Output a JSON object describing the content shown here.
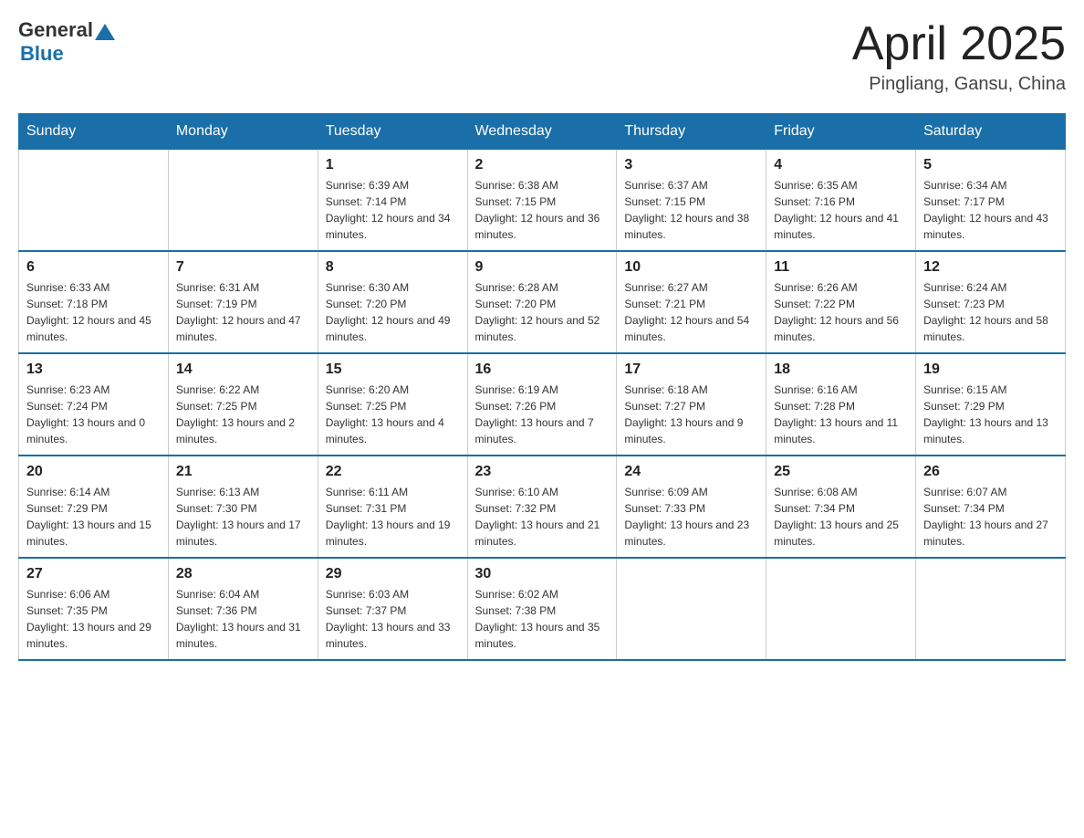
{
  "header": {
    "logo": {
      "text_general": "General",
      "text_blue": "Blue"
    },
    "title": "April 2025",
    "subtitle": "Pingliang, Gansu, China"
  },
  "calendar": {
    "days_of_week": [
      "Sunday",
      "Monday",
      "Tuesday",
      "Wednesday",
      "Thursday",
      "Friday",
      "Saturday"
    ],
    "weeks": [
      [
        {
          "day": "",
          "sunrise": "",
          "sunset": "",
          "daylight": ""
        },
        {
          "day": "",
          "sunrise": "",
          "sunset": "",
          "daylight": ""
        },
        {
          "day": "1",
          "sunrise": "Sunrise: 6:39 AM",
          "sunset": "Sunset: 7:14 PM",
          "daylight": "Daylight: 12 hours and 34 minutes."
        },
        {
          "day": "2",
          "sunrise": "Sunrise: 6:38 AM",
          "sunset": "Sunset: 7:15 PM",
          "daylight": "Daylight: 12 hours and 36 minutes."
        },
        {
          "day": "3",
          "sunrise": "Sunrise: 6:37 AM",
          "sunset": "Sunset: 7:15 PM",
          "daylight": "Daylight: 12 hours and 38 minutes."
        },
        {
          "day": "4",
          "sunrise": "Sunrise: 6:35 AM",
          "sunset": "Sunset: 7:16 PM",
          "daylight": "Daylight: 12 hours and 41 minutes."
        },
        {
          "day": "5",
          "sunrise": "Sunrise: 6:34 AM",
          "sunset": "Sunset: 7:17 PM",
          "daylight": "Daylight: 12 hours and 43 minutes."
        }
      ],
      [
        {
          "day": "6",
          "sunrise": "Sunrise: 6:33 AM",
          "sunset": "Sunset: 7:18 PM",
          "daylight": "Daylight: 12 hours and 45 minutes."
        },
        {
          "day": "7",
          "sunrise": "Sunrise: 6:31 AM",
          "sunset": "Sunset: 7:19 PM",
          "daylight": "Daylight: 12 hours and 47 minutes."
        },
        {
          "day": "8",
          "sunrise": "Sunrise: 6:30 AM",
          "sunset": "Sunset: 7:20 PM",
          "daylight": "Daylight: 12 hours and 49 minutes."
        },
        {
          "day": "9",
          "sunrise": "Sunrise: 6:28 AM",
          "sunset": "Sunset: 7:20 PM",
          "daylight": "Daylight: 12 hours and 52 minutes."
        },
        {
          "day": "10",
          "sunrise": "Sunrise: 6:27 AM",
          "sunset": "Sunset: 7:21 PM",
          "daylight": "Daylight: 12 hours and 54 minutes."
        },
        {
          "day": "11",
          "sunrise": "Sunrise: 6:26 AM",
          "sunset": "Sunset: 7:22 PM",
          "daylight": "Daylight: 12 hours and 56 minutes."
        },
        {
          "day": "12",
          "sunrise": "Sunrise: 6:24 AM",
          "sunset": "Sunset: 7:23 PM",
          "daylight": "Daylight: 12 hours and 58 minutes."
        }
      ],
      [
        {
          "day": "13",
          "sunrise": "Sunrise: 6:23 AM",
          "sunset": "Sunset: 7:24 PM",
          "daylight": "Daylight: 13 hours and 0 minutes."
        },
        {
          "day": "14",
          "sunrise": "Sunrise: 6:22 AM",
          "sunset": "Sunset: 7:25 PM",
          "daylight": "Daylight: 13 hours and 2 minutes."
        },
        {
          "day": "15",
          "sunrise": "Sunrise: 6:20 AM",
          "sunset": "Sunset: 7:25 PM",
          "daylight": "Daylight: 13 hours and 4 minutes."
        },
        {
          "day": "16",
          "sunrise": "Sunrise: 6:19 AM",
          "sunset": "Sunset: 7:26 PM",
          "daylight": "Daylight: 13 hours and 7 minutes."
        },
        {
          "day": "17",
          "sunrise": "Sunrise: 6:18 AM",
          "sunset": "Sunset: 7:27 PM",
          "daylight": "Daylight: 13 hours and 9 minutes."
        },
        {
          "day": "18",
          "sunrise": "Sunrise: 6:16 AM",
          "sunset": "Sunset: 7:28 PM",
          "daylight": "Daylight: 13 hours and 11 minutes."
        },
        {
          "day": "19",
          "sunrise": "Sunrise: 6:15 AM",
          "sunset": "Sunset: 7:29 PM",
          "daylight": "Daylight: 13 hours and 13 minutes."
        }
      ],
      [
        {
          "day": "20",
          "sunrise": "Sunrise: 6:14 AM",
          "sunset": "Sunset: 7:29 PM",
          "daylight": "Daylight: 13 hours and 15 minutes."
        },
        {
          "day": "21",
          "sunrise": "Sunrise: 6:13 AM",
          "sunset": "Sunset: 7:30 PM",
          "daylight": "Daylight: 13 hours and 17 minutes."
        },
        {
          "day": "22",
          "sunrise": "Sunrise: 6:11 AM",
          "sunset": "Sunset: 7:31 PM",
          "daylight": "Daylight: 13 hours and 19 minutes."
        },
        {
          "day": "23",
          "sunrise": "Sunrise: 6:10 AM",
          "sunset": "Sunset: 7:32 PM",
          "daylight": "Daylight: 13 hours and 21 minutes."
        },
        {
          "day": "24",
          "sunrise": "Sunrise: 6:09 AM",
          "sunset": "Sunset: 7:33 PM",
          "daylight": "Daylight: 13 hours and 23 minutes."
        },
        {
          "day": "25",
          "sunrise": "Sunrise: 6:08 AM",
          "sunset": "Sunset: 7:34 PM",
          "daylight": "Daylight: 13 hours and 25 minutes."
        },
        {
          "day": "26",
          "sunrise": "Sunrise: 6:07 AM",
          "sunset": "Sunset: 7:34 PM",
          "daylight": "Daylight: 13 hours and 27 minutes."
        }
      ],
      [
        {
          "day": "27",
          "sunrise": "Sunrise: 6:06 AM",
          "sunset": "Sunset: 7:35 PM",
          "daylight": "Daylight: 13 hours and 29 minutes."
        },
        {
          "day": "28",
          "sunrise": "Sunrise: 6:04 AM",
          "sunset": "Sunset: 7:36 PM",
          "daylight": "Daylight: 13 hours and 31 minutes."
        },
        {
          "day": "29",
          "sunrise": "Sunrise: 6:03 AM",
          "sunset": "Sunset: 7:37 PM",
          "daylight": "Daylight: 13 hours and 33 minutes."
        },
        {
          "day": "30",
          "sunrise": "Sunrise: 6:02 AM",
          "sunset": "Sunset: 7:38 PM",
          "daylight": "Daylight: 13 hours and 35 minutes."
        },
        {
          "day": "",
          "sunrise": "",
          "sunset": "",
          "daylight": ""
        },
        {
          "day": "",
          "sunrise": "",
          "sunset": "",
          "daylight": ""
        },
        {
          "day": "",
          "sunrise": "",
          "sunset": "",
          "daylight": ""
        }
      ]
    ]
  }
}
